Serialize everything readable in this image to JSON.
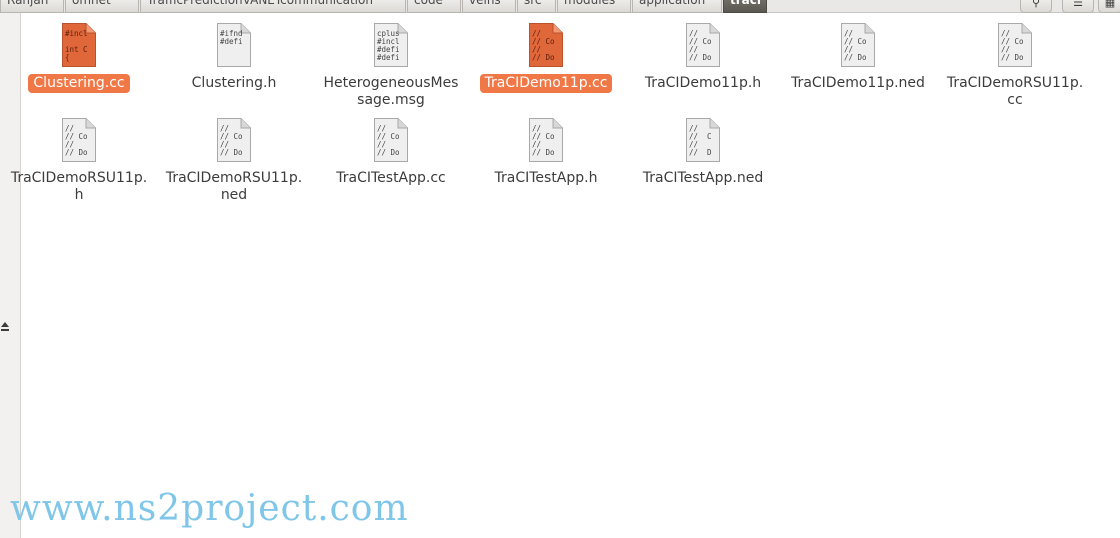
{
  "breadcrumbs": [
    "Ranjan",
    "omnet",
    "TrafficPredictionVANETcommunication",
    "code",
    "veins",
    "src",
    "modules",
    "application",
    "traci"
  ],
  "toolbar": {
    "search_icon": "search-icon",
    "view_icon": "list-view-icon",
    "menu_icon": "menu-icon"
  },
  "files": [
    {
      "name": "Clustering.cc",
      "selected": true,
      "preview": "#incl\n\nint C\n{"
    },
    {
      "name": "Clustering.h",
      "selected": false,
      "preview": "#ifnd\n#defi"
    },
    {
      "name": "HeterogeneousMessage.msg",
      "selected": false,
      "preview": "cplus\n#incl\n#defi\n#defi"
    },
    {
      "name": "TraCIDemo11p.cc",
      "selected": true,
      "preview": "//\n// Co\n//\n// Do"
    },
    {
      "name": "TraCIDemo11p.h",
      "selected": false,
      "preview": "//\n// Co\n//\n// Do"
    },
    {
      "name": "TraCIDemo11p.ned",
      "selected": false,
      "preview": "//\n// Co\n//\n// Do"
    },
    {
      "name": "TraCIDemoRSU11p.cc",
      "selected": false,
      "preview": "//\n// Co\n//\n// Do"
    },
    {
      "name": "TraCIDemoRSU11p.h",
      "selected": false,
      "preview": "//\n// Co\n//\n// Do"
    },
    {
      "name": "TraCIDemoRSU11p.ned",
      "selected": false,
      "preview": "//\n// Co\n//\n// Do"
    },
    {
      "name": "TraCITestApp.cc",
      "selected": false,
      "preview": "//\n// Co\n//\n// Do"
    },
    {
      "name": "TraCITestApp.h",
      "selected": false,
      "preview": "//\n// Co\n//\n// Do"
    },
    {
      "name": "TraCITestApp.ned",
      "selected": false,
      "preview": "//\n//  C\n//\n//  D"
    }
  ],
  "watermark": "www.ns2project.com",
  "colors": {
    "selection": "#f07746",
    "selected_icon": "#e0673a",
    "watermark": "#7fc6e8"
  }
}
